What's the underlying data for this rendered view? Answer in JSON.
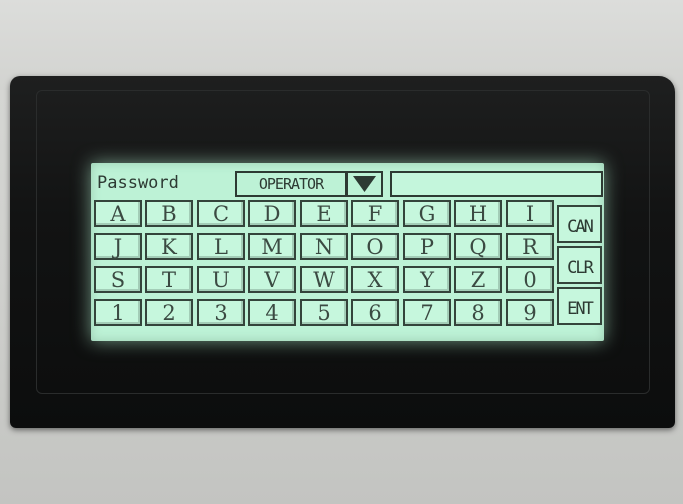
{
  "screen": {
    "password_label": "Password",
    "user_value": "OPERATOR",
    "dropdown_icon": "triangle-down",
    "password_value": ""
  },
  "keypad": {
    "rows": [
      [
        "A",
        "B",
        "C",
        "D",
        "E",
        "F",
        "G",
        "H",
        "I"
      ],
      [
        "J",
        "K",
        "L",
        "M",
        "N",
        "O",
        "P",
        "Q",
        "R"
      ],
      [
        "S",
        "T",
        "U",
        "V",
        "W",
        "X",
        "Y",
        "Z",
        "0"
      ],
      [
        "1",
        "2",
        "3",
        "4",
        "5",
        "6",
        "7",
        "8",
        "9"
      ]
    ],
    "side_keys": [
      "CAN",
      "CLR",
      "ENT"
    ]
  },
  "colors": {
    "lcd_background": "#bdf2d6",
    "lcd_ink": "#2d3a33",
    "bezel": "#121313"
  }
}
